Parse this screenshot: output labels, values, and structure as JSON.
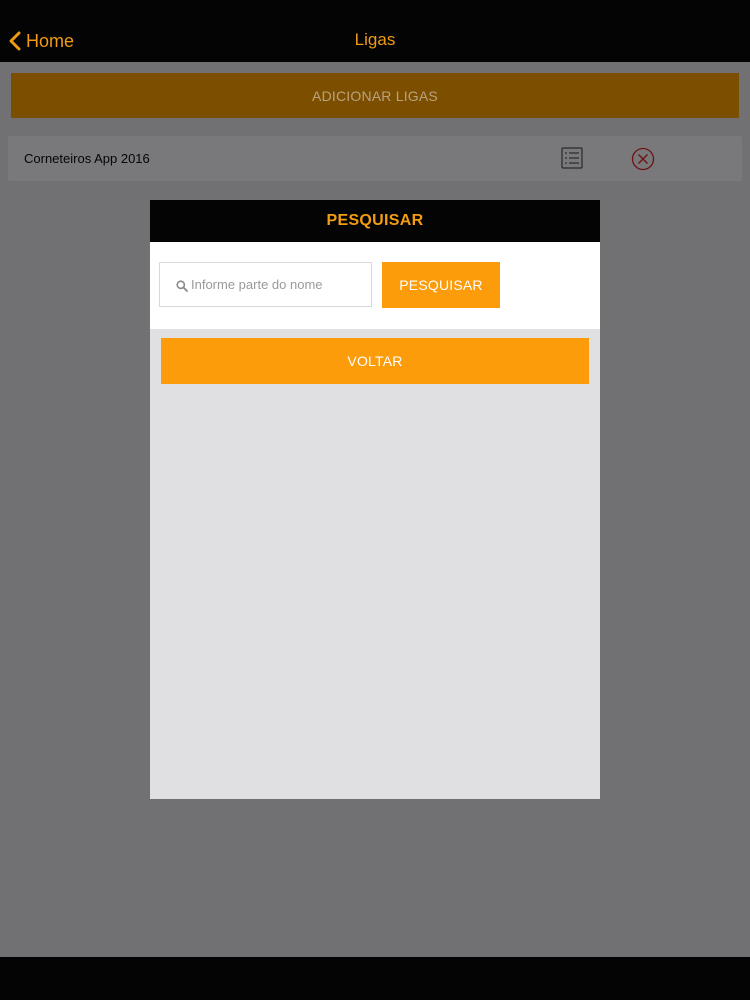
{
  "navbar": {
    "back_label": "Home",
    "title": "Ligas"
  },
  "main": {
    "add_button_label": "ADICIONAR LIGAS",
    "leagues": [
      {
        "name": "Corneteiros App 2016"
      }
    ]
  },
  "modal": {
    "title": "PESQUISAR",
    "search": {
      "placeholder": "Informe parte do nome",
      "value": "",
      "button_label": "PESQUISAR"
    },
    "back_button_label": "VOLTAR"
  },
  "icons": {
    "back": "chevron-left-icon",
    "list": "list-icon",
    "remove": "close-circle-icon",
    "search": "search-icon"
  },
  "colors": {
    "accent": "#fc9c0a",
    "nav_text": "#f19a14",
    "bar_background": "#040404",
    "overlay_background": "#717073"
  }
}
